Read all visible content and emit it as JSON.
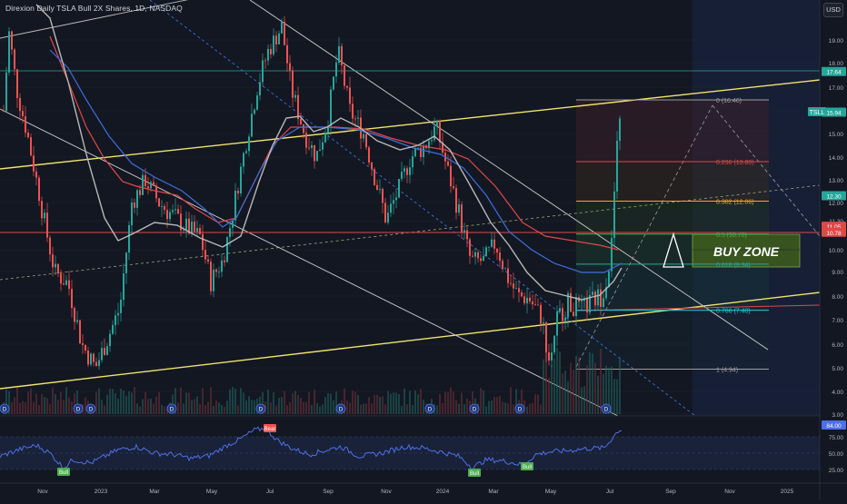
{
  "header": {
    "title": "Direxion Daily TSLA Bull 2X Shares, 1D, NASDAQ",
    "currency": "USD"
  },
  "colors": {
    "background": "#131722",
    "candle_up": "#26a69a",
    "candle_down": "#ef5350",
    "channel_yellow": "#f2e36b",
    "ma_blue": "#3d6fdc",
    "ma_red": "#e04848",
    "ma_gray": "#b8b8b8",
    "rsi": "#4f6fe8"
  },
  "price_axis": {
    "ticks": [
      "19.00",
      "18.00",
      "17.00",
      "16.00",
      "15.00",
      "14.00",
      "13.00",
      "12.00",
      "11.30",
      "10.00",
      "9.00",
      "8.00",
      "7.00",
      "6.00",
      "5.00",
      "4.00",
      "3.00"
    ],
    "badges": [
      {
        "label": "17.64",
        "price": 17.64,
        "color": "#26a69a"
      },
      {
        "label": "15.94",
        "price": 15.94,
        "color": "#26a69a"
      },
      {
        "label": "12.30",
        "price": 12.3,
        "color": "#26a69a"
      },
      {
        "label": "11.05",
        "price": 11.05,
        "color": "#e04848"
      },
      {
        "label": "10.78",
        "price": 10.78,
        "color": "#e04848"
      }
    ]
  },
  "rsi_axis": {
    "ticks": [
      "75.00",
      "50.00",
      "25.00"
    ],
    "current": {
      "label": "84.00",
      "color": "#4f6fe8"
    }
  },
  "time_axis": [
    "Nov",
    "2023",
    "Mar",
    "May",
    "Jul",
    "Sep",
    "Nov",
    "2024",
    "Mar",
    "May",
    "Jul",
    "Sep",
    "Nov",
    "2025"
  ],
  "fib_levels": [
    {
      "ratio": 0,
      "label": "0 (16.46)",
      "price": 16.46,
      "color": "#9e9e9e"
    },
    {
      "ratio": 0.236,
      "label": "0.236 (13.80)",
      "price": 13.8,
      "color": "#e04848"
    },
    {
      "ratio": 0.382,
      "label": "0.382 (12.06)",
      "price": 12.06,
      "color": "#f5a623"
    },
    {
      "ratio": 0.5,
      "label": "0.5 (10.70)",
      "price": 10.7,
      "color": "#4caf50"
    },
    {
      "ratio": 0.618,
      "label": "0.618 (9.34)",
      "price": 9.34,
      "color": "#26a69a"
    },
    {
      "ratio": 0.786,
      "label": "0.786 (7.40)",
      "price": 7.4,
      "color": "#26c6da"
    },
    {
      "ratio": 1,
      "label": "1 (4.94)",
      "price": 4.94,
      "color": "#9e9e9e"
    }
  ],
  "annotations": {
    "buy_zone": "BUY ZONE",
    "ticker_tag": "TSLL",
    "rsi_labels": [
      "Bull",
      "Bear",
      "Bull",
      "Bull"
    ],
    "event_markers": "D"
  }
}
